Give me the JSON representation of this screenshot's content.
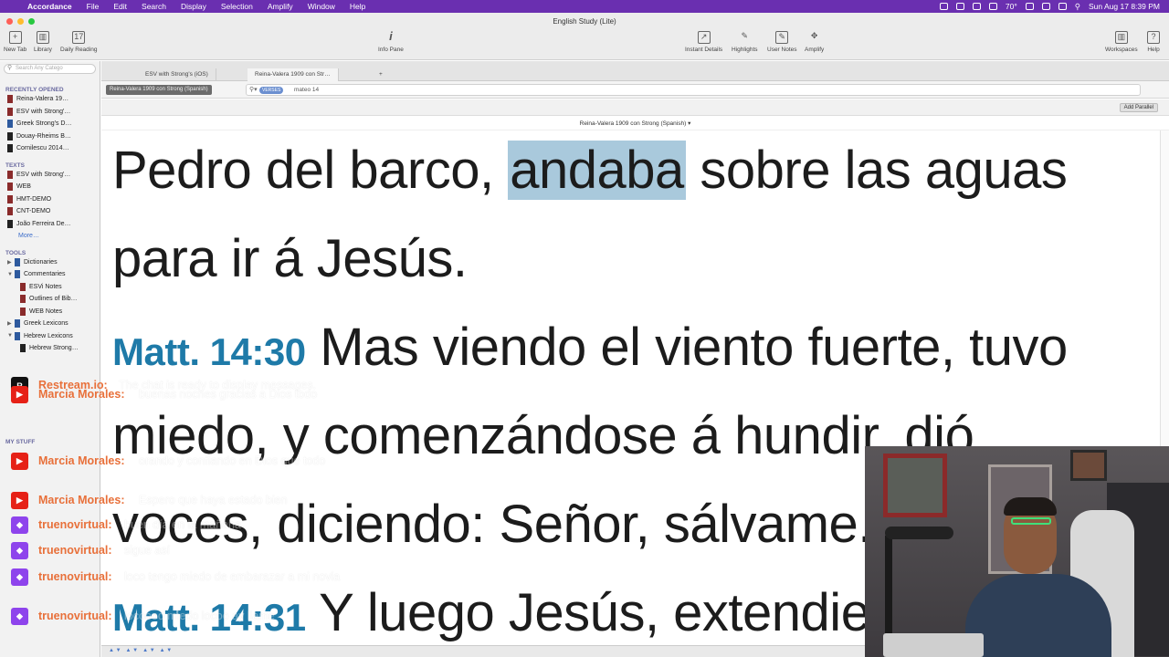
{
  "menubar": {
    "app": "Accordance",
    "menus": [
      "File",
      "Edit",
      "Search",
      "Display",
      "Selection",
      "Amplify",
      "Window",
      "Help"
    ],
    "temperature": "70°",
    "clock": "Sun Aug 17  8:39 PM"
  },
  "window": {
    "title": "English Study (Lite)"
  },
  "toolbar": {
    "new_tab": "New Tab",
    "library": "Library",
    "daily_reading": "Daily Reading",
    "info_pane": "Info Pane",
    "instant_details": "Instant Details",
    "highlights": "Highlights",
    "user_notes": "User Notes",
    "amplify": "Amplify",
    "workspaces": "Workspaces",
    "help": "Help"
  },
  "sidebar": {
    "search_placeholder": "Search Any Catego",
    "recently_opened_head": "RECENTLY OPENED",
    "recent": [
      "Reina-Valera 19…",
      "ESV with Strong'…",
      "Greek Strong's D…",
      "Douay-Rheims B…",
      "Cornilescu 2014…"
    ],
    "texts_head": "TEXTS",
    "texts": [
      "ESV with Strong'…",
      "WEB",
      "HMT-DEMO",
      "CNT-DEMO",
      "João Ferreira De…"
    ],
    "more": "More…",
    "tools_head": "TOOLS",
    "tools": [
      "Dictionaries",
      "Commentaries",
      "ESVi Notes",
      "Outlines of Bib…",
      "WEB Notes",
      "Greek Lexicons",
      "Hebrew Lexicons",
      "Hebrew Strong…"
    ],
    "mystuff_head": "MY STUFF"
  },
  "tabs": [
    "ESV with Strong's (iOS)",
    "Reina-Valera 1909 con Str…"
  ],
  "search": {
    "module": "Reina-Valera 1909 con Strong (Spanish)",
    "mode": "VERSES",
    "query": "mateo 14"
  },
  "add_parallel": "Add Parallel",
  "module_title": "Reina-Valera 1909 con Strong (Spanish) ▾",
  "text": {
    "line1_a": "Pedro del barco, ",
    "line1_hl": "andaba",
    "line1_b": " sobre las aguas",
    "line2": "para ir á Jesús.",
    "ref30": "Matt. 14:30",
    "line3": " Mas viendo el viento fuerte, tuvo",
    "line4": "miedo, y comenzándose á hundir, dió",
    "line5": "voces, diciendo: Señor, sálvame.",
    "ref31": "Matt. 14:31",
    "line6": " Y luego Jesús, extendiendo"
  },
  "chat": [
    {
      "platform": "restream",
      "icon": "R",
      "color": "#111111",
      "name": "Restream.io:",
      "text": "The chat is ready to display messages."
    },
    {
      "platform": "youtube",
      "icon": "▶",
      "color": "#e62117",
      "name": "Marcia Morales:",
      "text": "buenas noches gracias a Dios todo"
    },
    {
      "platform": "youtube",
      "icon": "▶",
      "color": "#e62117",
      "name": "Marcia Morales:",
      "text": "orando y confiando en Dios que todo"
    },
    {
      "platform": "youtube",
      "icon": "▶",
      "color": "#e62117",
      "name": "Marcia Morales:",
      "text": "Espero que haya estado bien"
    },
    {
      "platform": "twitch",
      "icon": "◆",
      "color": "#8e44ec",
      "name": "truenovirtual:",
      "text": "buen día en la mañana"
    },
    {
      "platform": "twitch",
      "icon": "◆",
      "color": "#8e44ec",
      "name": "truenovirtual:",
      "text": "sigue así"
    },
    {
      "platform": "twitch",
      "icon": "◆",
      "color": "#8e44ec",
      "name": "truenovirtual:",
      "text": "loco tengo miedo de embarazar a mi novia"
    },
    {
      "platform": "twitch",
      "icon": "◆",
      "color": "#8e44ec",
      "name": "truenovirtual:",
      "text": "locoooo miedo locoo ay llame"
    }
  ]
}
